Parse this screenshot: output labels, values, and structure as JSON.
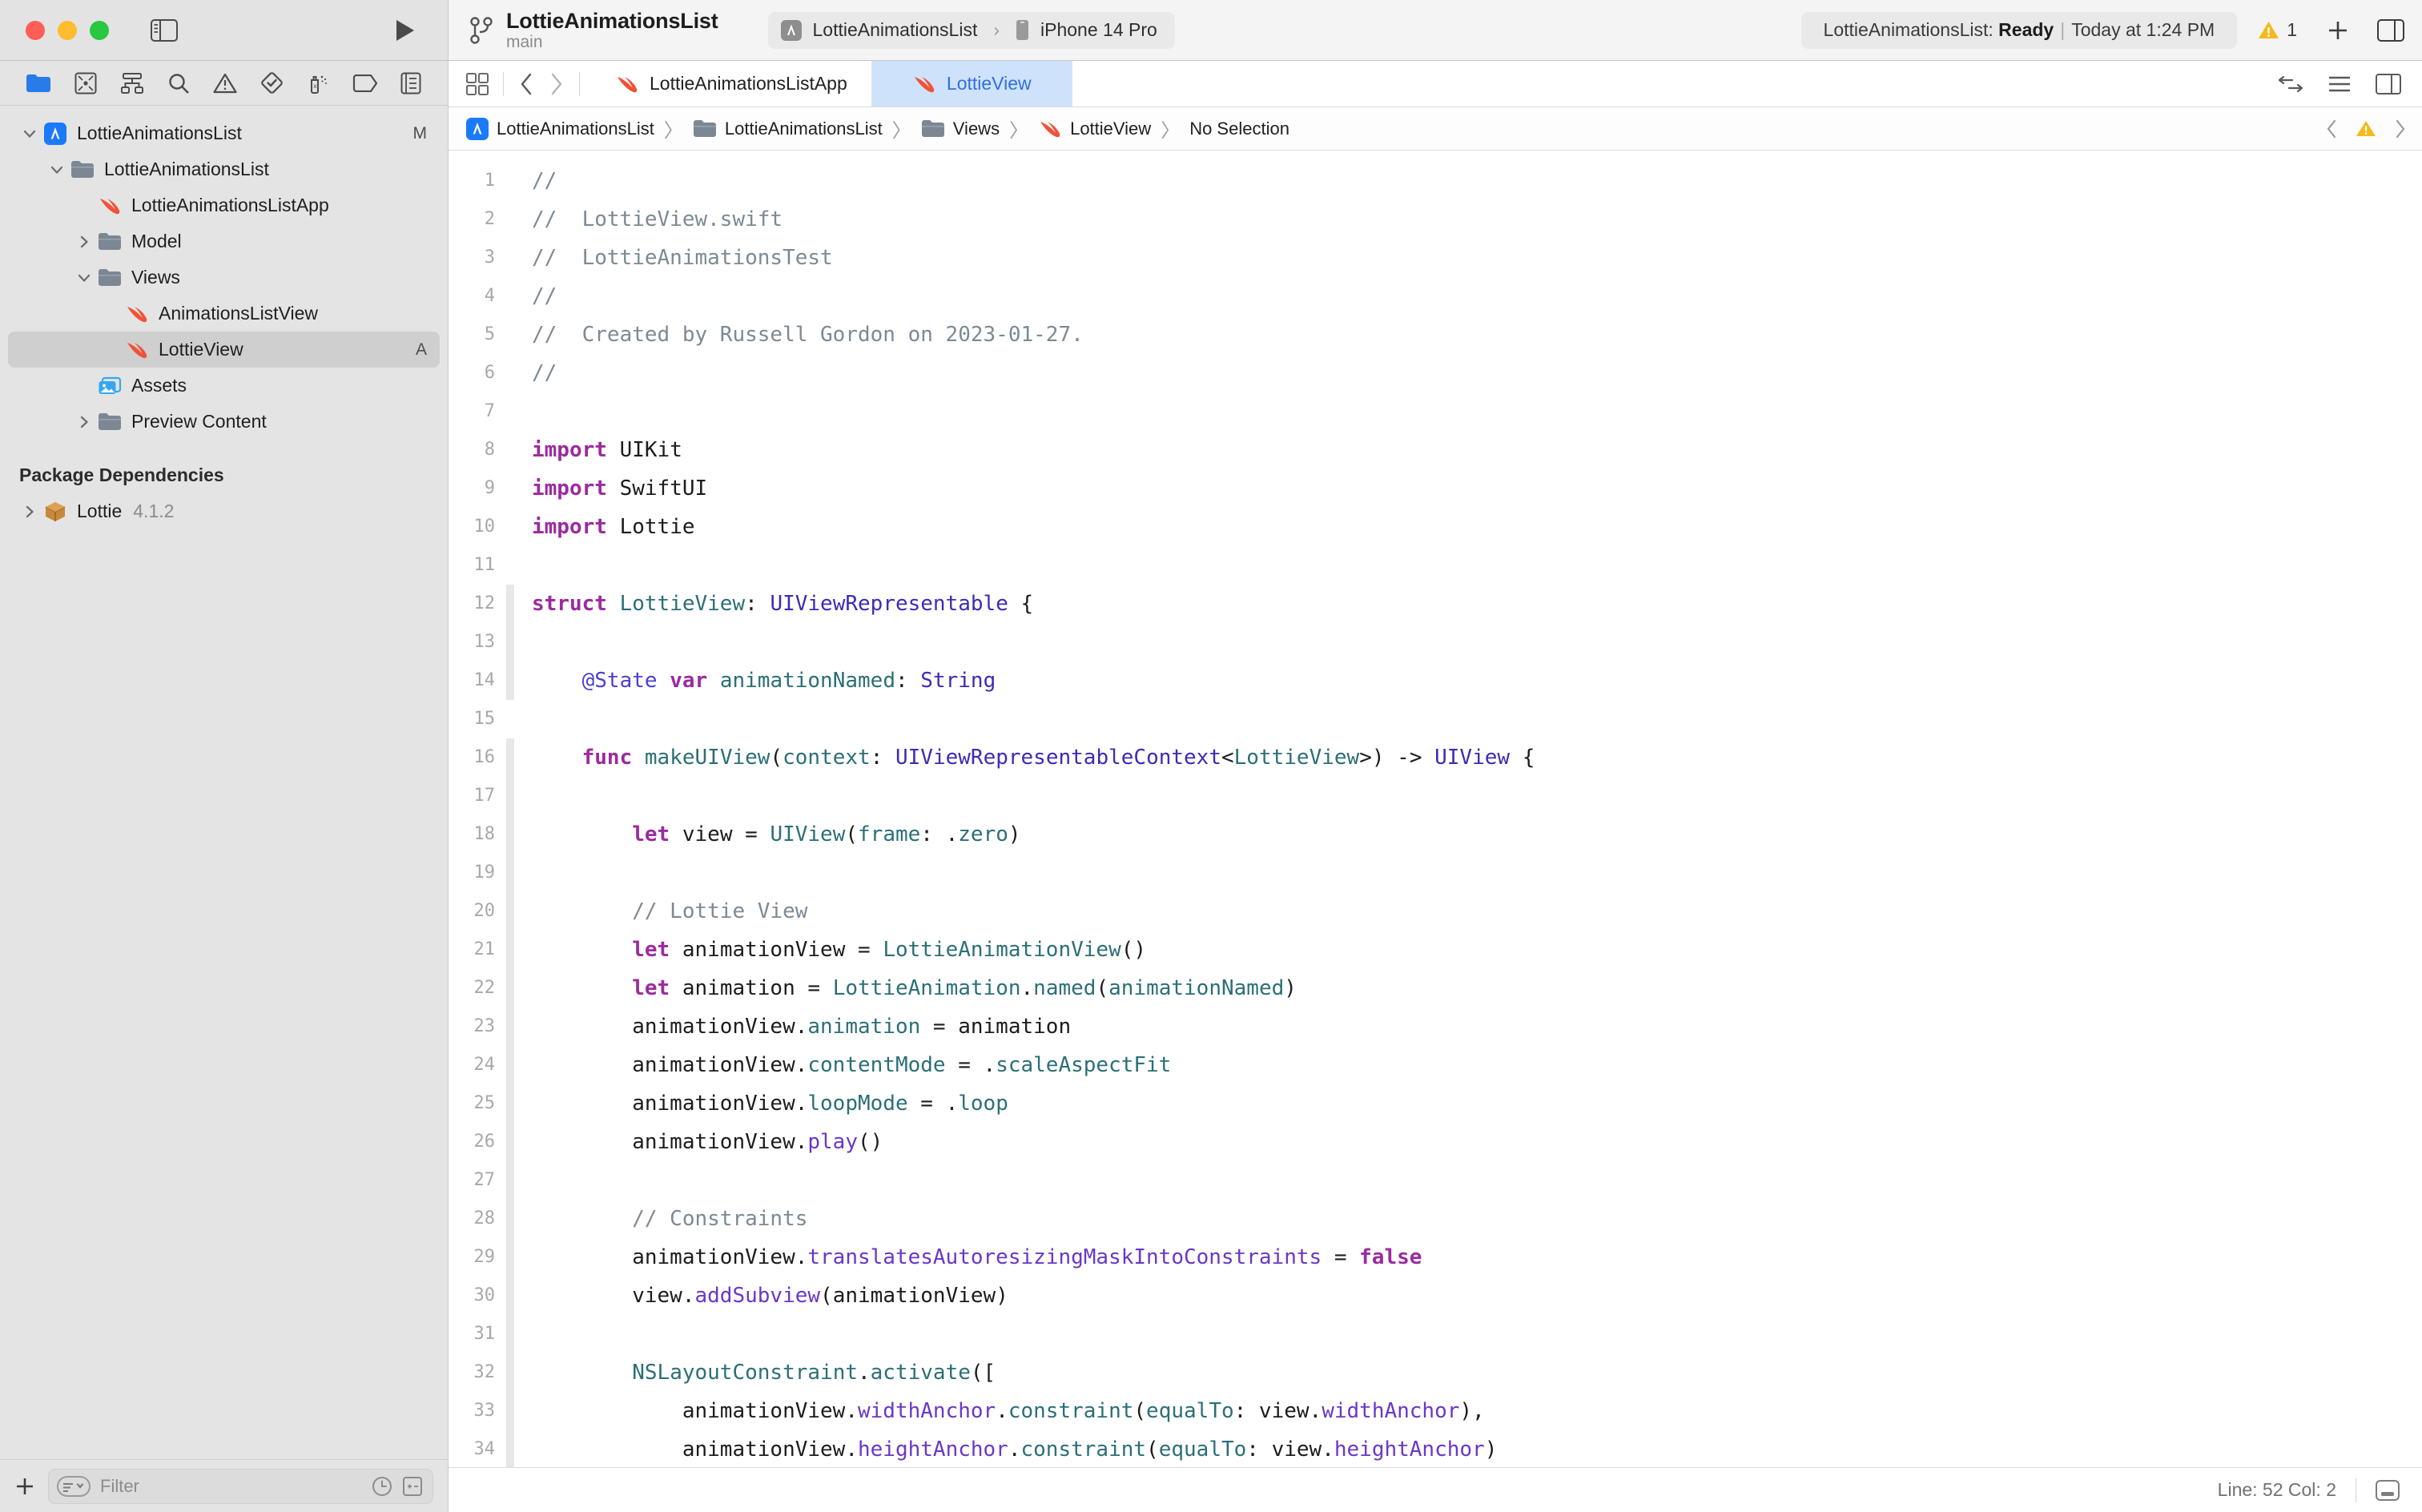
{
  "window": {
    "traffic_lights": [
      "close",
      "minimize",
      "zoom"
    ]
  },
  "toolbar": {
    "sidebar_toggle_icon": "sidebar-left-icon",
    "run_button_icon": "play-icon",
    "branch_icon": "git-branch-icon",
    "project_title": "LottieAnimationsList",
    "branch_name": "main",
    "scheme": {
      "app_icon": "app-store-icon",
      "scheme_name": "LottieAnimationsList",
      "separator": "›",
      "device_icon": "iphone-icon",
      "destination": "iPhone 14 Pro"
    },
    "status": {
      "prefix": "LottieAnimationsList: ",
      "state": "Ready",
      "divider": "|",
      "timestamp": "Today at 1:24 PM"
    },
    "warning": {
      "icon": "warning-triangle-icon",
      "count": "1"
    },
    "add_button_icon": "plus-icon",
    "inspector_toggle_icon": "sidebar-right-icon"
  },
  "navigator": {
    "tabs": [
      {
        "name": "project-navigator",
        "icon": "folder-icon",
        "active": true
      },
      {
        "name": "source-control-navigator",
        "icon": "source-control-icon",
        "active": false
      },
      {
        "name": "symbol-navigator",
        "icon": "hierarchy-icon",
        "active": false
      },
      {
        "name": "find-navigator",
        "icon": "search-icon",
        "active": false
      },
      {
        "name": "issue-navigator",
        "icon": "warning-triangle-icon",
        "active": false
      },
      {
        "name": "test-navigator",
        "icon": "diamond-check-icon",
        "active": false
      },
      {
        "name": "debug-navigator",
        "icon": "spray-icon",
        "active": false
      },
      {
        "name": "breakpoint-navigator",
        "icon": "tag-icon",
        "active": false
      },
      {
        "name": "report-navigator",
        "icon": "report-list-icon",
        "active": false
      }
    ],
    "tree": [
      {
        "label": "LottieAnimationsList",
        "icon": "app-store-icon",
        "indent": 0,
        "twisty": "down",
        "badge": "M",
        "selected": false
      },
      {
        "label": "LottieAnimationsList",
        "icon": "folder-gray-icon",
        "indent": 1,
        "twisty": "down",
        "badge": "",
        "selected": false
      },
      {
        "label": "LottieAnimationsListApp",
        "icon": "swift-icon",
        "indent": 2,
        "twisty": "none",
        "badge": "",
        "selected": false
      },
      {
        "label": "Model",
        "icon": "folder-gray-icon",
        "indent": 2,
        "twisty": "right",
        "badge": "",
        "selected": false
      },
      {
        "label": "Views",
        "icon": "folder-gray-icon",
        "indent": 2,
        "twisty": "down",
        "badge": "",
        "selected": false
      },
      {
        "label": "AnimationsListView",
        "icon": "swift-icon",
        "indent": 3,
        "twisty": "none",
        "badge": "",
        "selected": false
      },
      {
        "label": "LottieView",
        "icon": "swift-icon",
        "indent": 3,
        "twisty": "none",
        "badge": "A",
        "selected": true
      },
      {
        "label": "Assets",
        "icon": "assets-icon",
        "indent": 2,
        "twisty": "none",
        "badge": "",
        "selected": false
      },
      {
        "label": "Preview Content",
        "icon": "folder-gray-icon",
        "indent": 2,
        "twisty": "right",
        "badge": "",
        "selected": false
      }
    ],
    "section_header": "Package Dependencies",
    "packages": [
      {
        "label": "Lottie",
        "version": "4.1.2",
        "icon": "package-icon",
        "twisty": "right"
      }
    ],
    "bottom": {
      "add_icon": "plus-icon",
      "filter_scope_icon": "filter-scope-icon",
      "filter_placeholder": "Filter",
      "recent_icon": "clock-icon",
      "sourcecontrol_icon": "plus-minus-icon"
    }
  },
  "editor": {
    "controls": {
      "grid_icon": "editor-grid-icon",
      "back_icon": "chevron-left-icon",
      "forward_icon": "chevron-right-icon"
    },
    "tabs": [
      {
        "label": "LottieAnimationsListApp",
        "icon": "swift-icon",
        "active": false
      },
      {
        "label": "LottieView",
        "icon": "swift-icon",
        "active": true
      }
    ],
    "tabbar_right": [
      {
        "name": "code-review-icon"
      },
      {
        "name": "editor-options-icon"
      },
      {
        "name": "add-editor-icon"
      }
    ],
    "breadcrumb": [
      {
        "label": "LottieAnimationsList",
        "icon": "app-store-icon"
      },
      {
        "label": "LottieAnimationsList",
        "icon": "folder-gray-icon"
      },
      {
        "label": "Views",
        "icon": "folder-gray-icon"
      },
      {
        "label": "LottieView",
        "icon": "swift-icon"
      },
      {
        "label": "No Selection",
        "icon": ""
      }
    ],
    "breadcrumb_separator": "〉",
    "breadcrumb_right": {
      "back_icon": "chevron-left-small-icon",
      "warning_icon": "warning-triangle-icon",
      "forward_icon": "chevron-right-small-icon"
    },
    "status_line": {
      "position": "Line: 52  Col: 2",
      "minimap_icon": "minimap-icon"
    }
  },
  "code": {
    "first_line": 1,
    "lines": [
      {
        "n": 1,
        "modified": false,
        "tokens": [
          {
            "t": "//",
            "c": "cmt"
          }
        ]
      },
      {
        "n": 2,
        "modified": false,
        "tokens": [
          {
            "t": "//  LottieView.swift",
            "c": "cmt"
          }
        ]
      },
      {
        "n": 3,
        "modified": false,
        "tokens": [
          {
            "t": "//  LottieAnimationsTest",
            "c": "cmt"
          }
        ]
      },
      {
        "n": 4,
        "modified": false,
        "tokens": [
          {
            "t": "//",
            "c": "cmt"
          }
        ]
      },
      {
        "n": 5,
        "modified": false,
        "tokens": [
          {
            "t": "//  Created by Russell Gordon on 2023-01-27.",
            "c": "cmt"
          }
        ]
      },
      {
        "n": 6,
        "modified": false,
        "tokens": [
          {
            "t": "//",
            "c": "cmt"
          }
        ]
      },
      {
        "n": 7,
        "modified": false,
        "tokens": []
      },
      {
        "n": 8,
        "modified": false,
        "tokens": [
          {
            "t": "import",
            "c": "kw"
          },
          {
            "t": " UIKit",
            "c": "plain"
          }
        ]
      },
      {
        "n": 9,
        "modified": false,
        "tokens": [
          {
            "t": "import",
            "c": "kw"
          },
          {
            "t": " SwiftUI",
            "c": "plain"
          }
        ]
      },
      {
        "n": 10,
        "modified": false,
        "tokens": [
          {
            "t": "import",
            "c": "kw"
          },
          {
            "t": " Lottie",
            "c": "plain"
          }
        ]
      },
      {
        "n": 11,
        "modified": false,
        "tokens": []
      },
      {
        "n": 12,
        "modified": true,
        "tokens": [
          {
            "t": "struct",
            "c": "kw"
          },
          {
            "t": " ",
            "c": "plain"
          },
          {
            "t": "LottieView",
            "c": "typ2"
          },
          {
            "t": ": ",
            "c": "plain"
          },
          {
            "t": "UIViewRepresentable",
            "c": "typ"
          },
          {
            "t": " {",
            "c": "plain"
          }
        ]
      },
      {
        "n": 13,
        "modified": true,
        "tokens": []
      },
      {
        "n": 14,
        "modified": true,
        "tokens": [
          {
            "t": "    ",
            "c": "plain"
          },
          {
            "t": "@State",
            "c": "attr"
          },
          {
            "t": " ",
            "c": "plain"
          },
          {
            "t": "var",
            "c": "kw"
          },
          {
            "t": " ",
            "c": "plain"
          },
          {
            "t": "animationNamed",
            "c": "typ2"
          },
          {
            "t": ": ",
            "c": "plain"
          },
          {
            "t": "String",
            "c": "typ"
          }
        ]
      },
      {
        "n": 15,
        "modified": false,
        "tokens": []
      },
      {
        "n": 16,
        "modified": true,
        "tokens": [
          {
            "t": "    ",
            "c": "plain"
          },
          {
            "t": "func",
            "c": "kw"
          },
          {
            "t": " ",
            "c": "plain"
          },
          {
            "t": "makeUIView",
            "c": "typ2"
          },
          {
            "t": "(",
            "c": "plain"
          },
          {
            "t": "context",
            "c": "typ2"
          },
          {
            "t": ": ",
            "c": "plain"
          },
          {
            "t": "UIViewRepresentableContext",
            "c": "typ"
          },
          {
            "t": "<",
            "c": "plain"
          },
          {
            "t": "LottieView",
            "c": "typ2"
          },
          {
            "t": ">) -> ",
            "c": "plain"
          },
          {
            "t": "UIView",
            "c": "typ"
          },
          {
            "t": " {",
            "c": "plain"
          }
        ]
      },
      {
        "n": 17,
        "modified": true,
        "tokens": []
      },
      {
        "n": 18,
        "modified": true,
        "tokens": [
          {
            "t": "        ",
            "c": "plain"
          },
          {
            "t": "let",
            "c": "kw"
          },
          {
            "t": " view = ",
            "c": "plain"
          },
          {
            "t": "UIView",
            "c": "typ2"
          },
          {
            "t": "(",
            "c": "plain"
          },
          {
            "t": "frame",
            "c": "mem"
          },
          {
            "t": ": .",
            "c": "plain"
          },
          {
            "t": "zero",
            "c": "mem"
          },
          {
            "t": ")",
            "c": "plain"
          }
        ]
      },
      {
        "n": 19,
        "modified": true,
        "tokens": []
      },
      {
        "n": 20,
        "modified": true,
        "tokens": [
          {
            "t": "        // Lottie View",
            "c": "cmt"
          }
        ]
      },
      {
        "n": 21,
        "modified": true,
        "tokens": [
          {
            "t": "        ",
            "c": "plain"
          },
          {
            "t": "let",
            "c": "kw"
          },
          {
            "t": " animationView = ",
            "c": "plain"
          },
          {
            "t": "LottieAnimationView",
            "c": "typ2"
          },
          {
            "t": "()",
            "c": "plain"
          }
        ]
      },
      {
        "n": 22,
        "modified": true,
        "tokens": [
          {
            "t": "        ",
            "c": "plain"
          },
          {
            "t": "let",
            "c": "kw"
          },
          {
            "t": " animation = ",
            "c": "plain"
          },
          {
            "t": "LottieAnimation",
            "c": "typ2"
          },
          {
            "t": ".",
            "c": "plain"
          },
          {
            "t": "named",
            "c": "mem"
          },
          {
            "t": "(",
            "c": "plain"
          },
          {
            "t": "animationNamed",
            "c": "mem"
          },
          {
            "t": ")",
            "c": "plain"
          }
        ]
      },
      {
        "n": 23,
        "modified": true,
        "tokens": [
          {
            "t": "        animationView.",
            "c": "plain"
          },
          {
            "t": "animation",
            "c": "mem"
          },
          {
            "t": " = animation",
            "c": "plain"
          }
        ]
      },
      {
        "n": 24,
        "modified": true,
        "tokens": [
          {
            "t": "        animationView.",
            "c": "plain"
          },
          {
            "t": "contentMode",
            "c": "mem"
          },
          {
            "t": " = .",
            "c": "plain"
          },
          {
            "t": "scaleAspectFit",
            "c": "mem"
          }
        ]
      },
      {
        "n": 25,
        "modified": true,
        "tokens": [
          {
            "t": "        animationView.",
            "c": "plain"
          },
          {
            "t": "loopMode",
            "c": "mem"
          },
          {
            "t": " = .",
            "c": "plain"
          },
          {
            "t": "loop",
            "c": "mem"
          }
        ]
      },
      {
        "n": 26,
        "modified": true,
        "tokens": [
          {
            "t": "        animationView.",
            "c": "plain"
          },
          {
            "t": "play",
            "c": "fn"
          },
          {
            "t": "()",
            "c": "plain"
          }
        ]
      },
      {
        "n": 27,
        "modified": true,
        "tokens": []
      },
      {
        "n": 28,
        "modified": true,
        "tokens": [
          {
            "t": "        // Constraints",
            "c": "cmt"
          }
        ]
      },
      {
        "n": 29,
        "modified": true,
        "tokens": [
          {
            "t": "        animationView.",
            "c": "plain"
          },
          {
            "t": "translatesAutoresizingMaskIntoConstraints",
            "c": "fn"
          },
          {
            "t": " = ",
            "c": "plain"
          },
          {
            "t": "false",
            "c": "kw"
          }
        ]
      },
      {
        "n": 30,
        "modified": true,
        "tokens": [
          {
            "t": "        view.",
            "c": "plain"
          },
          {
            "t": "addSubview",
            "c": "fn"
          },
          {
            "t": "(animationView)",
            "c": "plain"
          }
        ]
      },
      {
        "n": 31,
        "modified": true,
        "tokens": []
      },
      {
        "n": 32,
        "modified": true,
        "tokens": [
          {
            "t": "        ",
            "c": "plain"
          },
          {
            "t": "NSLayoutConstraint",
            "c": "typ2"
          },
          {
            "t": ".",
            "c": "plain"
          },
          {
            "t": "activate",
            "c": "mem"
          },
          {
            "t": "([",
            "c": "plain"
          }
        ]
      },
      {
        "n": 33,
        "modified": true,
        "tokens": [
          {
            "t": "            animationView.",
            "c": "plain"
          },
          {
            "t": "widthAnchor",
            "c": "fn"
          },
          {
            "t": ".",
            "c": "plain"
          },
          {
            "t": "constraint",
            "c": "mem"
          },
          {
            "t": "(",
            "c": "plain"
          },
          {
            "t": "equalTo",
            "c": "mem"
          },
          {
            "t": ": view.",
            "c": "plain"
          },
          {
            "t": "widthAnchor",
            "c": "fn"
          },
          {
            "t": "),",
            "c": "plain"
          }
        ]
      },
      {
        "n": 34,
        "modified": true,
        "tokens": [
          {
            "t": "            animationView.",
            "c": "plain"
          },
          {
            "t": "heightAnchor",
            "c": "fn"
          },
          {
            "t": ".",
            "c": "plain"
          },
          {
            "t": "constraint",
            "c": "mem"
          },
          {
            "t": "(",
            "c": "plain"
          },
          {
            "t": "equalTo",
            "c": "mem"
          },
          {
            "t": ": view.",
            "c": "plain"
          },
          {
            "t": "heightAnchor",
            "c": "fn"
          },
          {
            "t": ")",
            "c": "plain"
          }
        ]
      }
    ]
  }
}
